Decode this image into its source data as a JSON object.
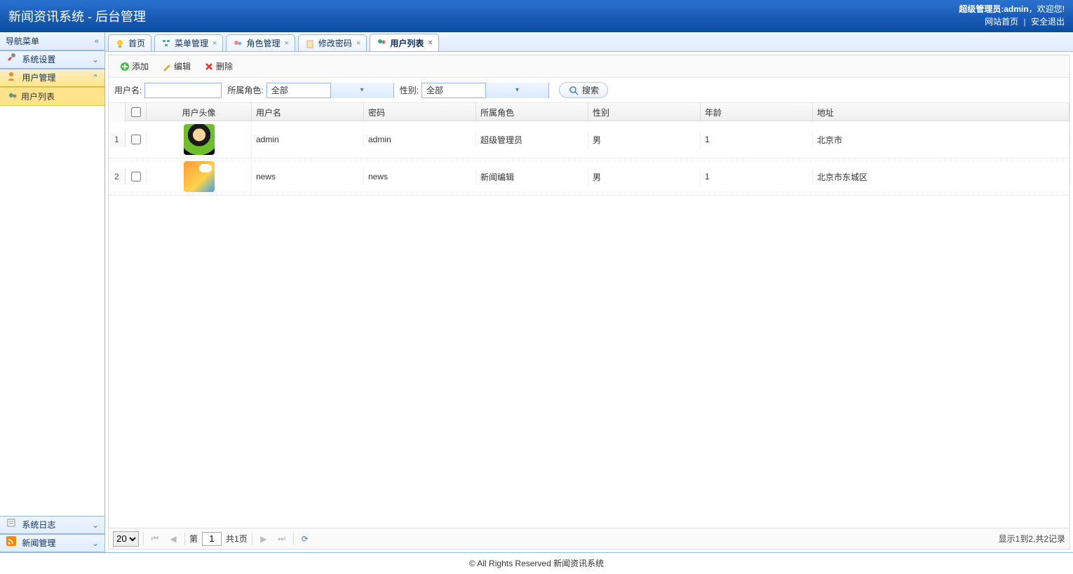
{
  "header": {
    "title": "新闻资讯系统 - 后台管理",
    "welcome_prefix": "超级管理员:",
    "welcome_user": "admin",
    "welcome_suffix": "，欢迎您!",
    "link_home": "网站首页",
    "link_logout": "安全退出"
  },
  "sidebar": {
    "title": "导航菜单",
    "sections": [
      {
        "label": "系统设置",
        "expanded": false
      },
      {
        "label": "用户管理",
        "expanded": true,
        "items": [
          {
            "label": "用户列表",
            "selected": true
          }
        ]
      },
      {
        "label": "系统日志",
        "expanded": false
      },
      {
        "label": "新闻管理",
        "expanded": false
      }
    ]
  },
  "tabs": [
    {
      "label": "首页",
      "closable": false,
      "active": false,
      "icon": "home"
    },
    {
      "label": "菜单管理",
      "closable": true,
      "active": false,
      "icon": "menu"
    },
    {
      "label": "角色管理",
      "closable": true,
      "active": false,
      "icon": "role"
    },
    {
      "label": "修改密码",
      "closable": true,
      "active": false,
      "icon": "pwd"
    },
    {
      "label": "用户列表",
      "closable": true,
      "active": true,
      "icon": "user"
    }
  ],
  "toolbar": {
    "add": "添加",
    "edit": "编辑",
    "delete": "删除"
  },
  "search": {
    "username_label": "用户名:",
    "username_value": "",
    "role_label": "所属角色:",
    "role_value": "全部",
    "sex_label": "性别:",
    "sex_value": "全部",
    "button": "搜索"
  },
  "grid": {
    "columns": {
      "avatar": "用户头像",
      "username": "用户名",
      "password": "密码",
      "role": "所属角色",
      "sex": "性别",
      "age": "年龄",
      "address": "地址"
    },
    "rows": [
      {
        "num": "1",
        "avatar": "1",
        "username": "admin",
        "password": "admin",
        "role": "超级管理员",
        "sex": "男",
        "age": "1",
        "address": "北京市"
      },
      {
        "num": "2",
        "avatar": "2",
        "username": "news",
        "password": "news",
        "role": "新闻编辑",
        "sex": "男",
        "age": "1",
        "address": "北京市东城区"
      }
    ]
  },
  "pager": {
    "page_size": "20",
    "page_label_prefix": "第",
    "page_value": "1",
    "page_total": "共1页",
    "info": "显示1到2,共2记录"
  },
  "footer": "© All Rights Reserved 新闻资讯系统"
}
